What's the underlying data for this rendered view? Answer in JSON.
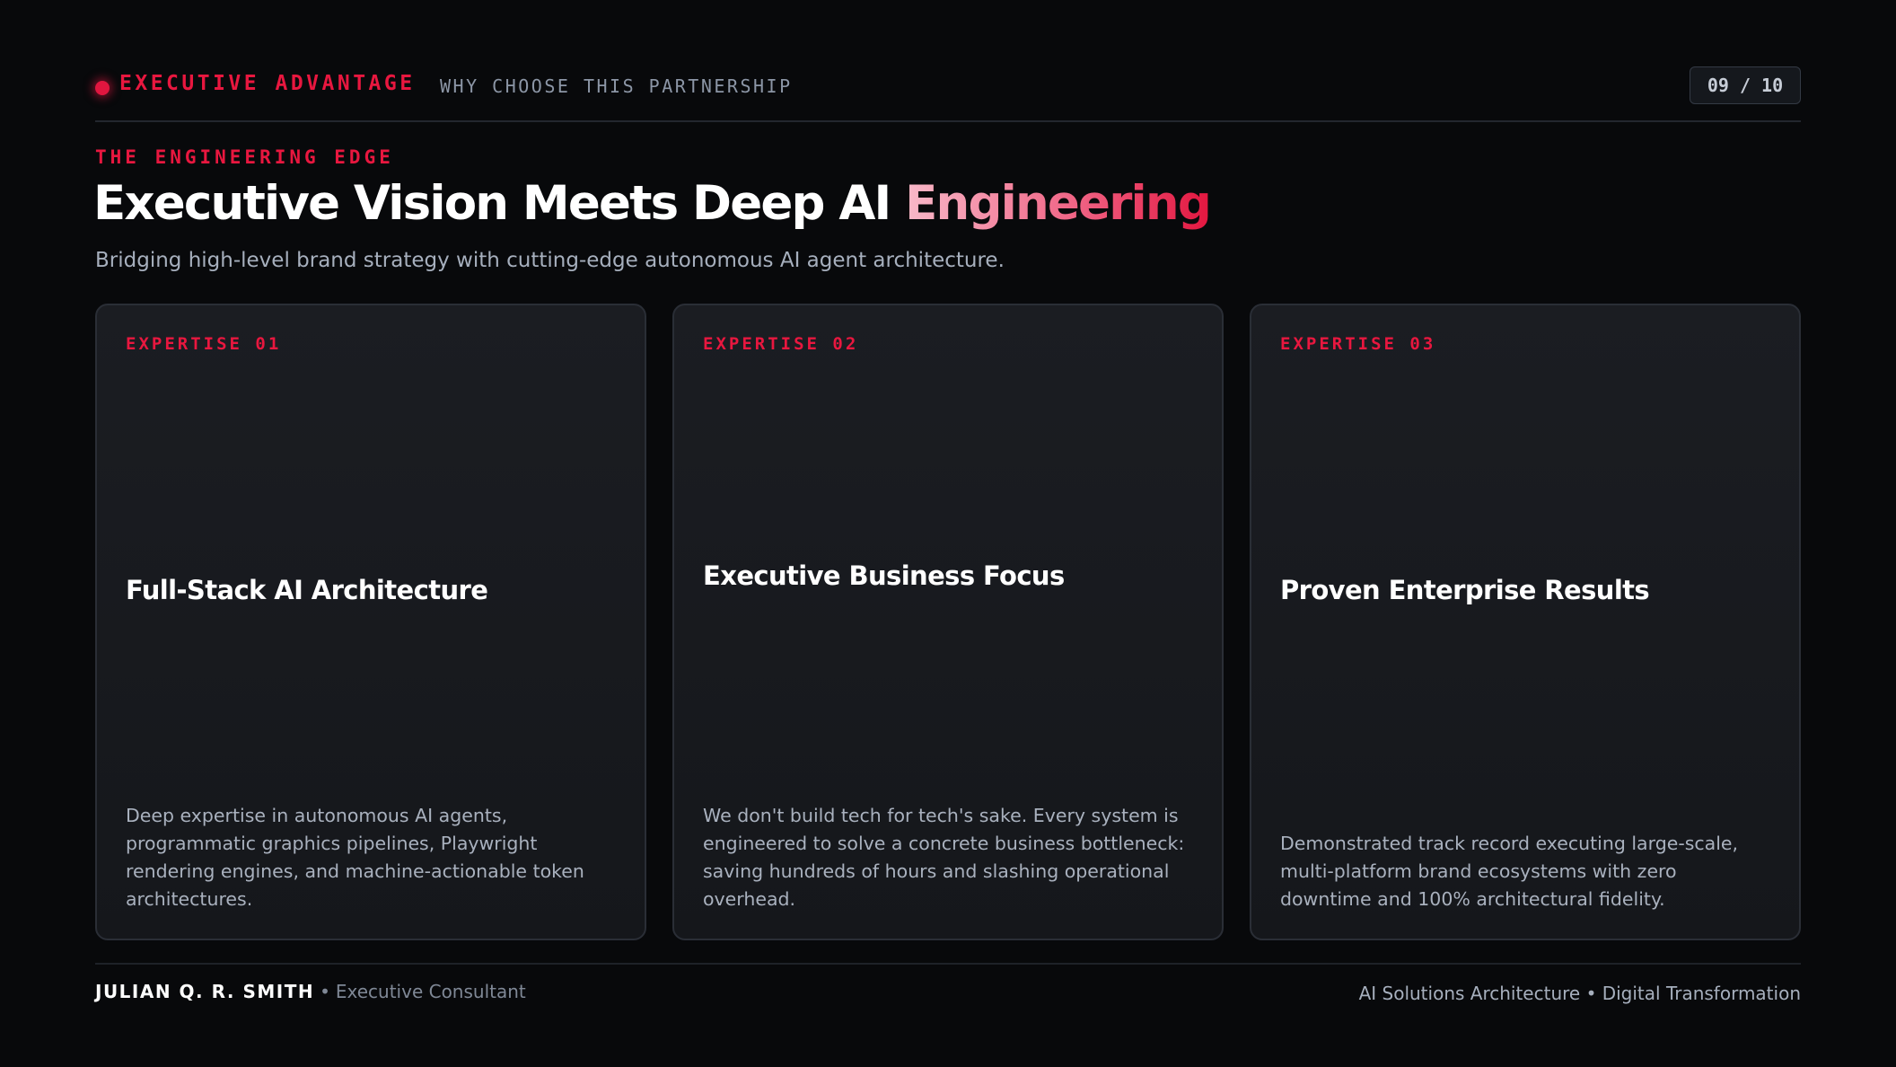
{
  "header": {
    "brand": "EXECUTIVE ADVANTAGE",
    "section": "WHY CHOOSE THIS PARTNERSHIP",
    "page_counter": "09 / 10"
  },
  "hero": {
    "eyebrow": "THE ENGINEERING EDGE",
    "title_main": "Executive Vision Meets Deep AI ",
    "title_accent": "Engineering",
    "subtitle": "Bridging high-level brand strategy with cutting-edge autonomous AI agent architecture."
  },
  "cards": [
    {
      "label": "EXPERTISE 01",
      "title": "Full-Stack AI Architecture",
      "body": "Deep expertise in autonomous AI agents, programmatic graphics pipelines, Playwright rendering engines, and machine-actionable token architectures."
    },
    {
      "label": "EXPERTISE 02",
      "title": "Executive Business Focus",
      "body": "We don't build tech for tech's sake. Every system is engineered to solve a concrete business bottleneck: saving hundreds of hours and slashing operational overhead."
    },
    {
      "label": "EXPERTISE 03",
      "title": "Proven Enterprise Results",
      "body": "Demonstrated track record executing large-scale, multi-platform brand ecosystems with zero downtime and 100% architectural fidelity."
    }
  ],
  "footer": {
    "presenter": "JULIAN Q. R. SMITH",
    "separator": "•",
    "role": "Executive Consultant",
    "tagline": "AI Solutions Architecture • Digital Transformation"
  },
  "colors": {
    "accent": "#e8173f",
    "background": "#08090b",
    "card": "#1b1d22"
  }
}
